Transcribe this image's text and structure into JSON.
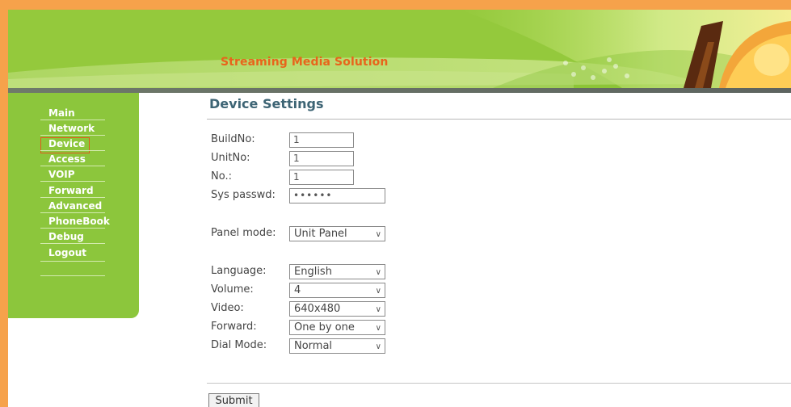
{
  "banner": {
    "title": "Streaming Media Solution"
  },
  "nav": {
    "items": [
      "Main",
      "Network",
      "Device",
      "Access",
      "VOIP",
      "Forward",
      "Advanced",
      "PhoneBook",
      "Debug",
      "Logout"
    ],
    "selected": "Device"
  },
  "page": {
    "title": "Device Settings"
  },
  "form": {
    "build_no": {
      "label": "BuildNo:",
      "value": "1"
    },
    "unit_no": {
      "label": "UnitNo:",
      "value": "1"
    },
    "no": {
      "label": "No.:",
      "value": "1"
    },
    "sys_passwd": {
      "label": "Sys passwd:",
      "value": "••••••"
    },
    "panel_mode": {
      "label": "Panel mode:",
      "value": "Unit Panel"
    },
    "language": {
      "label": "Language:",
      "value": "English"
    },
    "volume": {
      "label": "Volume:",
      "value": "4"
    },
    "video": {
      "label": "Video:",
      "value": "640x480"
    },
    "forward": {
      "label": "Forward:",
      "value": "One by one"
    },
    "dial_mode": {
      "label": "Dial Mode:",
      "value": "Normal"
    },
    "submit_label": "Submit"
  },
  "colors": {
    "frame": "#f6a24b",
    "banner_green": "#94c93c",
    "sidebar_green": "#8cc63c",
    "title_orange": "#e8641b",
    "heading_blue": "#3d6474",
    "highlight_red": "#e05a1c"
  },
  "icons": {
    "dropdown": "chevron-down-icon"
  }
}
